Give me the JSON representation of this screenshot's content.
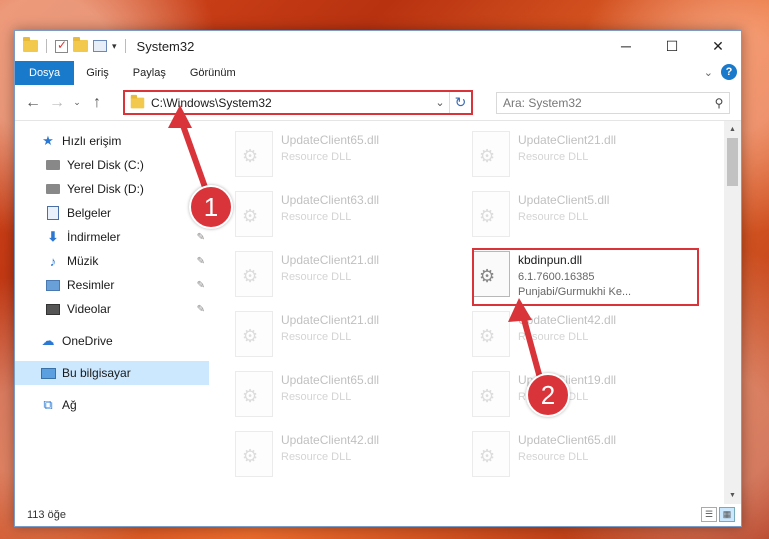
{
  "window": {
    "title": "System32",
    "controls": {
      "minimize": "─",
      "maximize": "☐",
      "close": "✕"
    }
  },
  "ribbon": {
    "tabs": [
      "Dosya",
      "Giriş",
      "Paylaş",
      "Görünüm"
    ],
    "expand_chevron": "⌄",
    "help": "?"
  },
  "nav": {
    "back": "←",
    "forward": "→",
    "recent": "⌄",
    "up": "↑",
    "address": "C:\\Windows\\System32",
    "address_dropdown": "⌄",
    "refresh": "↻",
    "search_placeholder": "Ara: System32"
  },
  "sidebar": {
    "items": [
      {
        "label": "Hızlı erişim",
        "icon": "star-icon",
        "glyph": "★",
        "pinned": false,
        "group": "quick"
      },
      {
        "label": "Yerel Disk (C:)",
        "icon": "drive-icon",
        "pinned": false,
        "group": "quick-sub"
      },
      {
        "label": "Yerel Disk (D:)",
        "icon": "drive-icon",
        "pinned": false,
        "group": "quick-sub"
      },
      {
        "label": "Belgeler",
        "icon": "documents-icon",
        "pinned": true,
        "group": "quick-sub"
      },
      {
        "label": "İndirmeler",
        "icon": "downloads-icon",
        "glyph": "⬇",
        "pinned": true,
        "group": "quick-sub"
      },
      {
        "label": "Müzik",
        "icon": "music-icon",
        "glyph": "♪",
        "pinned": true,
        "group": "quick-sub"
      },
      {
        "label": "Resimler",
        "icon": "pictures-icon",
        "pinned": true,
        "group": "quick-sub"
      },
      {
        "label": "Videolar",
        "icon": "videos-icon",
        "pinned": true,
        "group": "quick-sub"
      },
      {
        "label": "OneDrive",
        "icon": "onedrive-icon",
        "glyph": "☁",
        "pinned": false,
        "group": "root"
      },
      {
        "label": "Bu bilgisayar",
        "icon": "computer-icon",
        "pinned": false,
        "group": "root",
        "selected": true
      },
      {
        "label": "Ağ",
        "icon": "network-icon",
        "glyph": "⧉",
        "pinned": false,
        "group": "root"
      }
    ],
    "pin_glyph": "📌"
  },
  "files": [
    {
      "name": "UpdateClient65.dll",
      "type": "Resource DLL",
      "col": 0,
      "row": 0
    },
    {
      "name": "UpdateClient21.dll",
      "type": "Resource DLL",
      "col": 1,
      "row": 0
    },
    {
      "name": "UpdateClient63.dll",
      "type": "Resource DLL",
      "col": 0,
      "row": 1
    },
    {
      "name": "UpdateClient5.dll",
      "type": "Resource DLL",
      "col": 1,
      "row": 1
    },
    {
      "name": "UpdateClient21.dll",
      "type": "Resource DLL",
      "col": 0,
      "row": 2
    },
    {
      "name": "kbdinpun.dll",
      "version": "6.1.7600.16385",
      "type": "Punjabi/Gurmukhi Ke...",
      "col": 1,
      "row": 2,
      "highlighted": true
    },
    {
      "name": "UpdateClient21.dll",
      "type": "Resource DLL",
      "col": 0,
      "row": 3
    },
    {
      "name": "UpdateClient42.dll",
      "type": "Resource DLL",
      "col": 1,
      "row": 3
    },
    {
      "name": "UpdateClient65.dll",
      "type": "Resource DLL",
      "col": 0,
      "row": 4
    },
    {
      "name": "UpdateClient19.dll",
      "type": "Resource DLL",
      "col": 1,
      "row": 4
    },
    {
      "name": "UpdateClient42.dll",
      "type": "Resource DLL",
      "col": 0,
      "row": 5
    },
    {
      "name": "UpdateClient65.dll",
      "type": "Resource DLL",
      "col": 1,
      "row": 5
    }
  ],
  "status": {
    "item_count": "113 öğe"
  },
  "annotations": {
    "step1": "1",
    "step2": "2",
    "color": "#d9343a"
  },
  "colors": {
    "accent": "#1979ca",
    "selection": "#cce8ff",
    "annotation_red": "#d9343a"
  }
}
